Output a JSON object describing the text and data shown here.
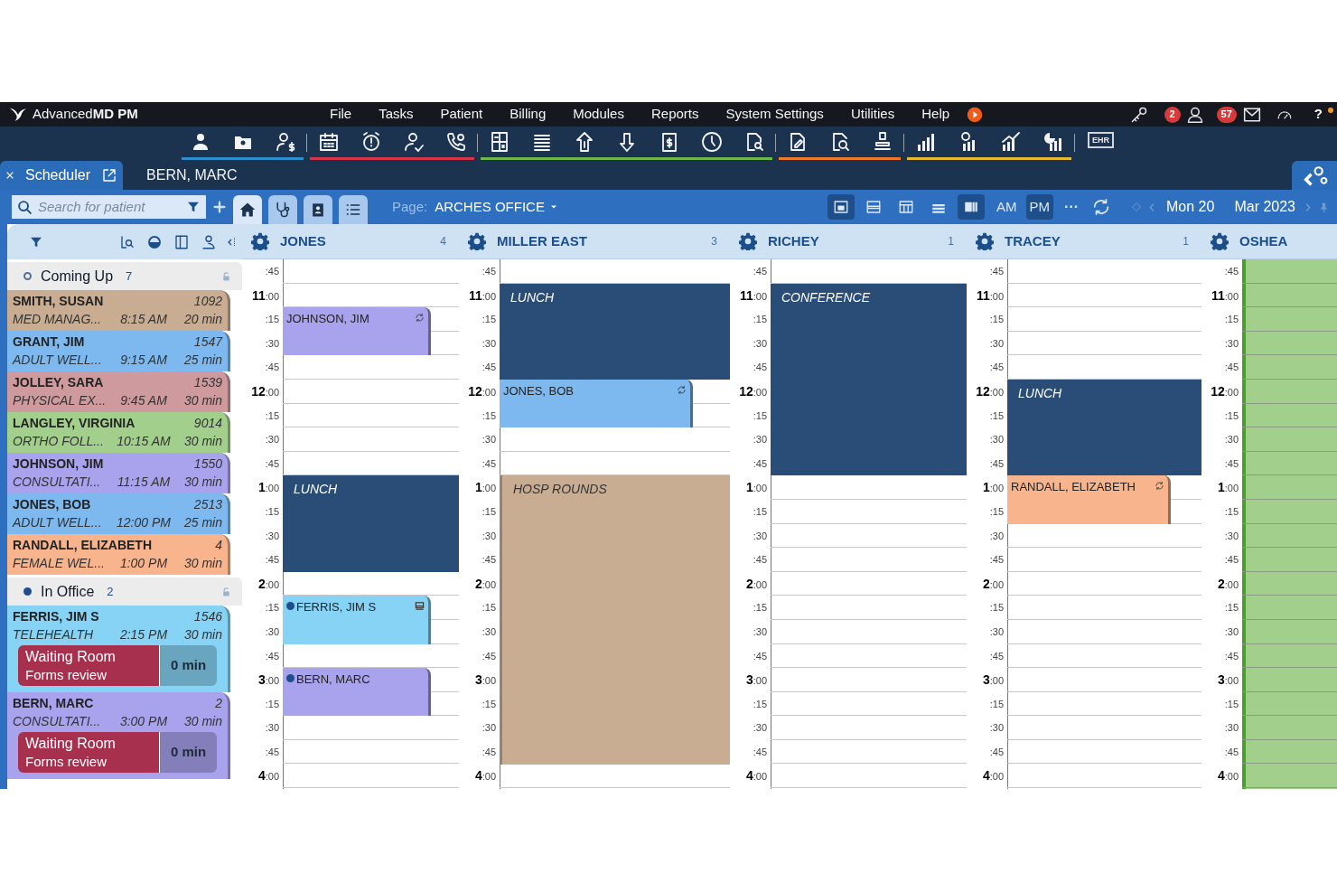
{
  "app": {
    "logo_text": "Advanced**MD PM**"
  },
  "menu": [
    "File",
    "Tasks",
    "Patient",
    "Billing",
    "Modules",
    "Reports",
    "System Settings",
    "Utilities",
    "Help"
  ],
  "notifications": [
    {
      "count": "2"
    },
    {
      "count": "57"
    }
  ],
  "help_label": "?",
  "toolbar_groups": [
    {
      "color": "#2c8fd0"
    },
    {
      "color": "#d9334a"
    },
    {
      "color": "#6cb84a"
    },
    {
      "color": "#f07a2a"
    },
    {
      "color": "#e8b830"
    }
  ],
  "ehr_label": "EHR",
  "tabs": [
    {
      "label": "Scheduler",
      "selected": true
    },
    {
      "label": "BERN, MARC",
      "selected": false
    }
  ],
  "search": {
    "placeholder": "Search for patient"
  },
  "nav_buttons": [
    {
      "selected": true
    },
    {
      "selected": false
    },
    {
      "selected": false
    },
    {
      "selected": false
    }
  ],
  "page_label": "Page:",
  "page_value": "ARCHES OFFICE",
  "view_buttons": [
    {
      "selected": true
    },
    {
      "selected": false
    },
    {
      "selected": false
    },
    {
      "selected": false
    },
    {
      "selected": true
    }
  ],
  "ampm": [
    {
      "label": "AM",
      "selected": false
    },
    {
      "label": "PM",
      "selected": true
    }
  ],
  "more_label": "···",
  "day_label": "Mon 20",
  "month_label": "Mar 2023",
  "sidebar": {
    "groups": [
      {
        "title": "Coming Up",
        "count": "7",
        "dot_filled": false,
        "cards": [
          {
            "name": "SMITH, SUSAN",
            "id": "1092",
            "type": "MED MANAG...",
            "time": "8:15 AM",
            "duration": "20 min",
            "color": "#c9ad93"
          },
          {
            "name": "GRANT, JIM",
            "id": "1547",
            "type": "ADULT WELL...",
            "time": "9:15 AM",
            "duration": "25 min",
            "color": "#7db8ef"
          },
          {
            "name": "JOLLEY, SARA",
            "id": "1539",
            "type": "PHYSICAL EX...",
            "time": "9:45 AM",
            "duration": "30 min",
            "color": "#cf9a9e"
          },
          {
            "name": "LANGLEY, VIRGINIA",
            "id": "9014",
            "type": "ORTHO FOLL...",
            "time": "10:15 AM",
            "duration": "30 min",
            "color": "#a3cf8d"
          },
          {
            "name": "JOHNSON, JIM",
            "id": "1550",
            "type": "CONSULTATI...",
            "time": "11:15 AM",
            "duration": "30 min",
            "color": "#a9a3ee"
          },
          {
            "name": "JONES, BOB",
            "id": "2513",
            "type": "ADULT WELL...",
            "time": "12:00 PM",
            "duration": "25 min",
            "color": "#7db8ef"
          },
          {
            "name": "RANDALL, ELIZABETH",
            "id": "4",
            "type": "FEMALE WEL...",
            "time": "1:00 PM",
            "duration": "30 min",
            "color": "#f8b48c"
          }
        ]
      },
      {
        "title": "In Office",
        "count": "2",
        "dot_filled": true,
        "cards": [
          {
            "name": "FERRIS, JIM S",
            "id": "1546",
            "type": "TELEHEALTH",
            "time": "2:15 PM",
            "duration": "30 min",
            "color": "#87d3f5",
            "status": "Waiting Room",
            "substatus": "Forms review",
            "wait": "0 min"
          },
          {
            "name": "BERN, MARC",
            "id": "2",
            "type": "CONSULTATI...",
            "time": "3:00 PM",
            "duration": "30 min",
            "color": "#a9a3ee",
            "status": "Waiting Room",
            "substatus": "Forms review",
            "wait": "0 min"
          }
        ]
      }
    ]
  },
  "columns": [
    {
      "name": "JONES",
      "count": "4",
      "highlight": false,
      "slots": [
        {
          "time": ":45",
          "event_ends": false
        },
        {
          "time": "**11**:00",
          "event_ends": false
        },
        {
          "time": ":15",
          "event_ends": false,
          "event": {
            "kind": "appointment",
            "label": "JOHNSON, JIM",
            "color": "#a9a3ee",
            "arrived": false,
            "telehealth": false,
            "sync_icon": true
          }
        },
        {
          "time": ":30",
          "event_ends": true
        },
        {
          "time": ":45",
          "event_ends": false
        },
        {
          "time": "**12**:00",
          "event_ends": false
        },
        {
          "time": ":15",
          "event_ends": false
        },
        {
          "time": ":30",
          "event_ends": false
        },
        {
          "time": ":45",
          "event_ends": false
        },
        {
          "time": "**1**:00",
          "event_ends": false,
          "event": {
            "kind": "block",
            "label": "LUNCH",
            "color": "#2a4d78"
          }
        },
        {
          "time": ":15",
          "event_ends": false
        },
        {
          "time": ":30",
          "event_ends": false
        },
        {
          "time": ":45",
          "event_ends": true
        },
        {
          "time": "**2**:00",
          "event_ends": false
        },
        {
          "time": ":15",
          "event_ends": false,
          "event": {
            "kind": "appointment",
            "label": "FERRIS, JIM S",
            "color": "#87d3f5",
            "arrived": true,
            "telehealth": true,
            "sync_icon": false
          }
        },
        {
          "time": ":30",
          "event_ends": true
        },
        {
          "time": ":45",
          "event_ends": false
        },
        {
          "time": "**3**:00",
          "event_ends": false,
          "event": {
            "kind": "appointment",
            "label": "BERN, MARC",
            "color": "#a9a3ee",
            "arrived": true,
            "telehealth": false,
            "sync_icon": false
          }
        },
        {
          "time": ":15",
          "event_ends": true
        },
        {
          "time": ":30",
          "event_ends": false
        },
        {
          "time": ":45",
          "event_ends": false
        },
        {
          "time": "**4**:00",
          "event_ends": false
        }
      ]
    },
    {
      "name": "MILLER EAST",
      "count": "3",
      "highlight": false,
      "slots": [
        {
          "time": ":45",
          "event_ends": false
        },
        {
          "time": "**11**:00",
          "event_ends": false,
          "event": {
            "kind": "block",
            "label": "LUNCH",
            "color": "#2a4d78"
          }
        },
        {
          "time": ":15",
          "event_ends": false
        },
        {
          "time": ":30",
          "event_ends": false
        },
        {
          "time": ":45",
          "event_ends": true
        },
        {
          "time": "**12**:00",
          "event_ends": false,
          "event": {
            "kind": "appointment",
            "label": "JONES, BOB",
            "color": "#7db8ef",
            "arrived": false,
            "telehealth": false,
            "sync_icon": true
          }
        },
        {
          "time": ":15",
          "event_ends": true
        },
        {
          "time": ":30",
          "event_ends": false
        },
        {
          "time": ":45",
          "event_ends": false
        },
        {
          "time": "**1**:00",
          "event_ends": false,
          "event": {
            "kind": "block",
            "label": "HOSP ROUNDS",
            "color": "#c9ad93"
          }
        },
        {
          "time": ":15",
          "event_ends": false
        },
        {
          "time": ":30",
          "event_ends": false
        },
        {
          "time": ":45",
          "event_ends": false
        },
        {
          "time": "**2**:00",
          "event_ends": false
        },
        {
          "time": ":15",
          "event_ends": false
        },
        {
          "time": ":30",
          "event_ends": false
        },
        {
          "time": ":45",
          "event_ends": false
        },
        {
          "time": "**3**:00",
          "event_ends": false
        },
        {
          "time": ":15",
          "event_ends": false
        },
        {
          "time": ":30",
          "event_ends": false
        },
        {
          "time": ":45",
          "event_ends": true
        },
        {
          "time": "**4**:00",
          "event_ends": false
        }
      ]
    },
    {
      "name": "RICHEY",
      "count": "1",
      "highlight": false,
      "slots": [
        {
          "time": ":45",
          "event_ends": false
        },
        {
          "time": "**11**:00",
          "event_ends": false,
          "event": {
            "kind": "block",
            "label": "CONFERENCE",
            "color": "#2a4d78"
          }
        },
        {
          "time": ":15",
          "event_ends": false
        },
        {
          "time": ":30",
          "event_ends": false
        },
        {
          "time": ":45",
          "event_ends": false
        },
        {
          "time": "**12**:00",
          "event_ends": false
        },
        {
          "time": ":15",
          "event_ends": false
        },
        {
          "time": ":30",
          "event_ends": false
        },
        {
          "time": ":45",
          "event_ends": true
        },
        {
          "time": "**1**:00",
          "event_ends": false
        },
        {
          "time": ":15",
          "event_ends": false
        },
        {
          "time": ":30",
          "event_ends": false
        },
        {
          "time": ":45",
          "event_ends": false
        },
        {
          "time": "**2**:00",
          "event_ends": false
        },
        {
          "time": ":15",
          "event_ends": false
        },
        {
          "time": ":30",
          "event_ends": false
        },
        {
          "time": ":45",
          "event_ends": false
        },
        {
          "time": "**3**:00",
          "event_ends": false
        },
        {
          "time": ":15",
          "event_ends": false
        },
        {
          "time": ":30",
          "event_ends": false
        },
        {
          "time": ":45",
          "event_ends": false
        },
        {
          "time": "**4**:00",
          "event_ends": false
        }
      ]
    },
    {
      "name": "TRACEY",
      "count": "1",
      "highlight": false,
      "slots": [
        {
          "time": ":45",
          "event_ends": false
        },
        {
          "time": "**11**:00",
          "event_ends": false
        },
        {
          "time": ":15",
          "event_ends": false
        },
        {
          "time": ":30",
          "event_ends": false
        },
        {
          "time": ":45",
          "event_ends": false
        },
        {
          "time": "**12**:00",
          "event_ends": false,
          "event": {
            "kind": "block",
            "label": "LUNCH",
            "color": "#2a4d78"
          }
        },
        {
          "time": ":15",
          "event_ends": false
        },
        {
          "time": ":30",
          "event_ends": false
        },
        {
          "time": ":45",
          "event_ends": true
        },
        {
          "time": "**1**:00",
          "event_ends": false,
          "event": {
            "kind": "appointment",
            "label": "RANDALL, ELIZABETH",
            "color": "#f8b48c",
            "arrived": false,
            "telehealth": false,
            "sync_icon": true
          }
        },
        {
          "time": ":15",
          "event_ends": true
        },
        {
          "time": ":30",
          "event_ends": false
        },
        {
          "time": ":45",
          "event_ends": false
        },
        {
          "time": "**2**:00",
          "event_ends": false
        },
        {
          "time": ":15",
          "event_ends": false
        },
        {
          "time": ":30",
          "event_ends": false
        },
        {
          "time": ":45",
          "event_ends": false
        },
        {
          "time": "**3**:00",
          "event_ends": false
        },
        {
          "time": ":15",
          "event_ends": false
        },
        {
          "time": ":30",
          "event_ends": false
        },
        {
          "time": ":45",
          "event_ends": false
        },
        {
          "time": "**4**:00",
          "event_ends": false
        }
      ]
    },
    {
      "name": "OSHEA",
      "highlight": true,
      "slots": [
        {
          "time": ":45"
        },
        {
          "time": "**11**:00"
        },
        {
          "time": ":15"
        },
        {
          "time": ":30"
        },
        {
          "time": ":45"
        },
        {
          "time": "**12**:00"
        },
        {
          "time": ":15"
        },
        {
          "time": ":30"
        },
        {
          "time": ":45"
        },
        {
          "time": "**1**:00"
        },
        {
          "time": ":15"
        },
        {
          "time": ":30"
        },
        {
          "time": ":45"
        },
        {
          "time": "**2**:00"
        },
        {
          "time": ":15"
        },
        {
          "time": ":30"
        },
        {
          "time": ":45"
        },
        {
          "time": "**3**:00"
        },
        {
          "time": ":15"
        },
        {
          "time": ":30"
        },
        {
          "time": ":45"
        },
        {
          "time": "**4**:00"
        }
      ]
    }
  ]
}
